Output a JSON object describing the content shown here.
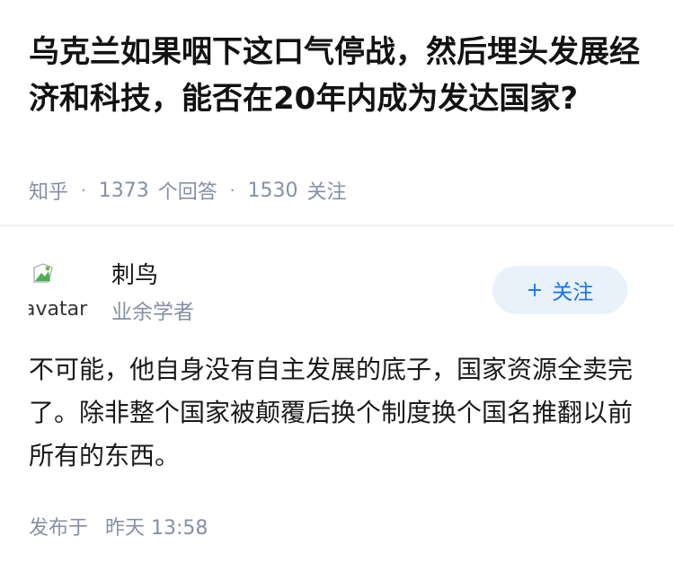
{
  "question": {
    "title": "乌克兰如果咽下这口气停战，然后埋头发展经济和科技，能否在20年内成为发达国家?",
    "source": "知乎",
    "answer_count": "1373",
    "answer_label": "个回答",
    "follower_count": "1530",
    "follower_label": "关注",
    "separator": "·"
  },
  "answer": {
    "author": {
      "name": "刺鸟",
      "bio": "业余学者",
      "avatar_alt": "avatar"
    },
    "follow_button": {
      "plus": "+",
      "label": "关注"
    },
    "content": "不可能，他自身没有自主发展的底子，国家资源全卖完了。除非整个国家被颠覆后换个制度换个国名推翻以前所有的东西。",
    "published_label": "发布于",
    "published_time": "昨天 13:58"
  },
  "colors": {
    "text": "#121212",
    "meta": "#8590a6",
    "accent": "#1772f6",
    "button_bg": "#e9f1fb"
  }
}
